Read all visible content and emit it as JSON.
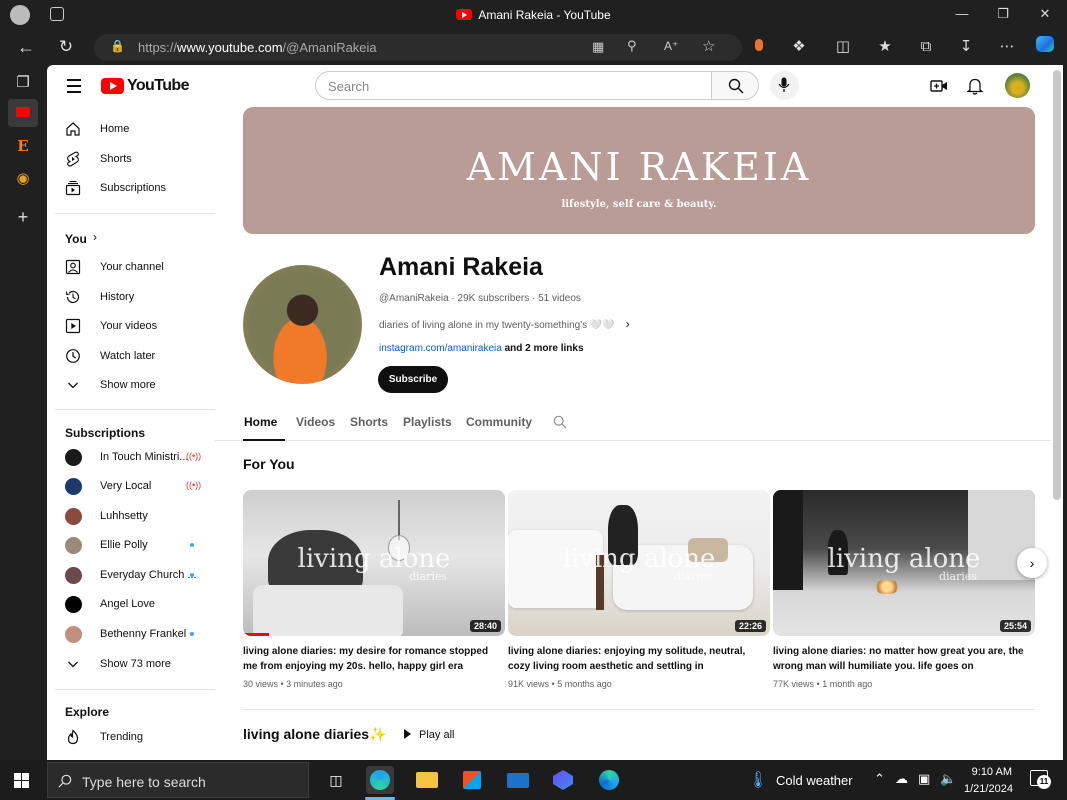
{
  "window": {
    "title": "Amani Rakeia - YouTube"
  },
  "browser": {
    "url_prefix": "https://",
    "url_domain": "www.youtube.com",
    "url_path": "/@AmaniRakeia"
  },
  "masthead": {
    "logo_text": "YouTube",
    "search_placeholder": "Search"
  },
  "guide": {
    "main": [
      {
        "label": "Home",
        "icon": "home-icon"
      },
      {
        "label": "Shorts",
        "icon": "shorts-icon"
      },
      {
        "label": "Subscriptions",
        "icon": "subscriptions-icon"
      }
    ],
    "you_title": "You",
    "you_items": [
      {
        "label": "Your channel",
        "icon": "channel-icon"
      },
      {
        "label": "History",
        "icon": "history-icon"
      },
      {
        "label": "Your videos",
        "icon": "your-videos-icon"
      },
      {
        "label": "Watch later",
        "icon": "clock-icon"
      },
      {
        "label": "Show more",
        "icon": "chevron-down-icon"
      }
    ],
    "subs_title": "Subscriptions",
    "subs": [
      {
        "label": "In Touch Ministri...",
        "status": "live",
        "color": "#1a1a1a"
      },
      {
        "label": "Very Local",
        "status": "live",
        "color": "#1b3a6b"
      },
      {
        "label": "Luhhsetty",
        "status": "",
        "color": "#8b4a3a"
      },
      {
        "label": "Ellie Polly",
        "status": "new",
        "color": "#9b8a7a"
      },
      {
        "label": "Everyday Church ...",
        "status": "new",
        "color": "#6a4a4a"
      },
      {
        "label": "Angel Love",
        "status": "",
        "color": "#000000"
      },
      {
        "label": "Bethenny Frankel",
        "status": "new",
        "color": "#c0907a"
      }
    ],
    "show_more_subs": "Show 73 more",
    "explore_title": "Explore",
    "explore_items": [
      {
        "label": "Trending",
        "icon": "trending-icon"
      }
    ]
  },
  "banner": {
    "title": "AMANI RAKEIA",
    "subtitle": "lifestyle, self care & beauty."
  },
  "channel": {
    "name": "Amani Rakeia",
    "handle": "@AmaniRakeia",
    "subscribers": "29K subscribers",
    "videos": "51 videos",
    "description": "diaries of living alone in my twenty-something's 🤍🤍",
    "link": "instagram.com/amanirakeia",
    "more_links": "and 2 more links",
    "subscribe_label": "Subscribe"
  },
  "tabs": [
    "Home",
    "Videos",
    "Shorts",
    "Playlists",
    "Community"
  ],
  "section_for_you": "For You",
  "videos": [
    {
      "title": "living alone diaries: my desire for romance stopped me from enjoying my 20s. hello, happy girl era",
      "views": "30 views",
      "age": "3 minutes ago",
      "duration": "28:40",
      "overlay": "living alone",
      "overlay_sub": "diaries",
      "progress": 0.1
    },
    {
      "title": "living alone diaries: enjoying my solitude, neutral, cozy living room aesthetic and settling in",
      "views": "91K views",
      "age": "5 months ago",
      "duration": "22:26",
      "overlay": "living alone",
      "overlay_sub": "diaries",
      "progress": 0
    },
    {
      "title": "living alone diaries: no matter how great you are, the wrong man will humiliate you. life goes on",
      "views": "77K views",
      "age": "1 month ago",
      "duration": "25:54",
      "overlay": "living alone",
      "overlay_sub": "diaries",
      "progress": 0
    }
  ],
  "playlist_section": {
    "title": "living alone diaries✨",
    "play_all": "Play all"
  },
  "taskbar": {
    "search_placeholder": "Type here to search",
    "weather": "Cold weather",
    "time": "9:10 AM",
    "date": "1/21/2024",
    "notif_count": "11"
  }
}
